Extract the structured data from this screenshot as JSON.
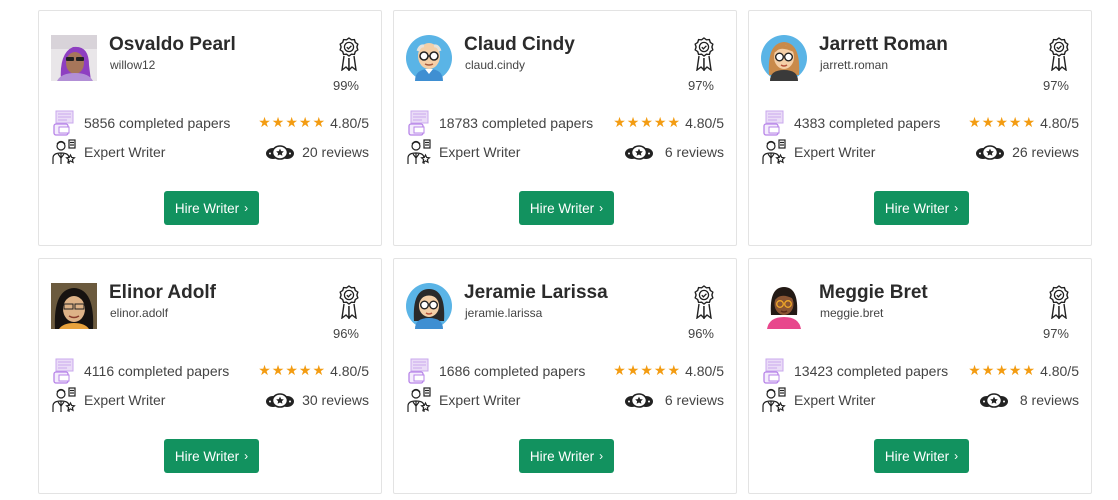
{
  "writers": [
    {
      "name": "Osvaldo Pearl",
      "username": "willow12",
      "success": "99%",
      "papers": "5856 completed papers",
      "stars": "★★★★★",
      "rating": "4.80/5",
      "level": "Expert Writer",
      "reviews": "20 reviews",
      "avatar": "photo-avatar-purple-hair"
    },
    {
      "name": "Claud Cindy",
      "username": "claud.cindy",
      "success": "97%",
      "papers": "18783 completed papers",
      "stars": "★★★★★",
      "rating": "4.80/5",
      "level": "Expert Writer",
      "reviews": "6 reviews",
      "avatar": "cartoon-avatar-bald-man-glasses"
    },
    {
      "name": "Jarrett Roman",
      "username": "jarrett.roman",
      "success": "97%",
      "papers": "4383 completed papers",
      "stars": "★★★★★",
      "rating": "4.80/5",
      "level": "Expert Writer",
      "reviews": "26 reviews",
      "avatar": "cartoon-avatar-woman-glasses"
    },
    {
      "name": "Elinor Adolf",
      "username": "elinor.adolf",
      "success": "96%",
      "papers": "4116 completed papers",
      "stars": "★★★★★",
      "rating": "4.80/5",
      "level": "Expert Writer",
      "reviews": "30 reviews",
      "avatar": "photo-avatar-dark-hair"
    },
    {
      "name": "Jeramie Larissa",
      "username": "jeramie.larissa",
      "success": "96%",
      "papers": "1686 completed papers",
      "stars": "★★★★★",
      "rating": "4.80/5",
      "level": "Expert Writer",
      "reviews": "6 reviews",
      "avatar": "cartoon-avatar-woman-bangs-glasses"
    },
    {
      "name": "Meggie Bret",
      "username": "meggie.bret",
      "success": "97%",
      "papers": "13423 completed papers",
      "stars": "★★★★★",
      "rating": "4.80/5",
      "level": "Expert Writer",
      "reviews": "8 reviews",
      "avatar": "cartoon-avatar-woman-pink-shirt"
    }
  ],
  "hire_label": "Hire Writer",
  "hire_chevron": "›",
  "colors": {
    "accent": "#12925f",
    "star": "#f39c12",
    "border": "#e3e3e3"
  },
  "icons": {
    "badge": "award-ribbon-icon",
    "papers": "papers-stack-icon",
    "writer": "writer-person-icon",
    "reviews": "reviews-bubbles-icon"
  }
}
